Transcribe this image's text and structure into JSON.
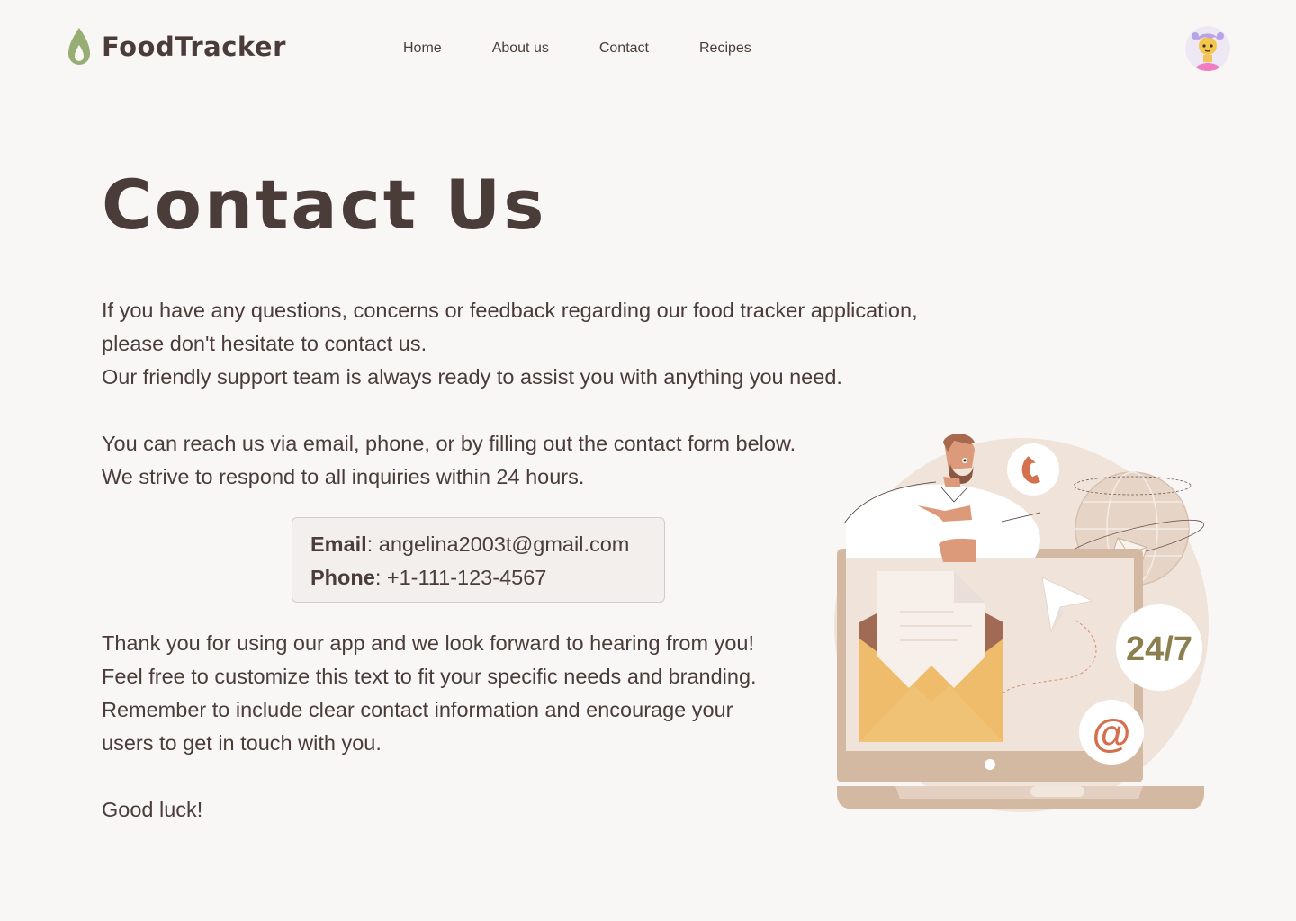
{
  "brand": {
    "name": "FoodTracker",
    "logo_icon": "leaf-drop-icon",
    "accent_color": "#96ad73"
  },
  "nav": {
    "items": [
      "Home",
      "About us",
      "Contact",
      "Recipes"
    ]
  },
  "user": {
    "avatar_icon": "user-avatar-icon"
  },
  "main": {
    "title": "Contact Us",
    "intro": "If you have any questions, concerns or feedback regarding our food tracker application,\nplease don't hesitate to contact us.\nOur friendly support team is always ready to assist you with anything you need.",
    "reach": "You can reach us via email, phone, or by filling out the contact form below.\nWe strive to respond to all inquiries within 24 hours.",
    "contact": {
      "email_label": "Email",
      "email_value": ": angelina2003t@gmail.com",
      "phone_label": "Phone",
      "phone_value": ": +1-111-123-4567"
    },
    "closing": "Thank you for using our app and we look forward to hearing from you!\nFeel free to customize this text to fit your specific needs and branding.\nRemember to include clear contact information and encourage your\n users to get in touch with you.",
    "signoff": "Good luck!"
  },
  "illustration": {
    "badge_247": "24/7",
    "at_symbol": "@",
    "icons": [
      "phone-icon",
      "envelope-icon",
      "paper-plane-icon",
      "globe-icon",
      "laptop-icon",
      "support-agent-icon"
    ]
  },
  "colors": {
    "background": "#f9f7f5",
    "text": "#4a3c39",
    "contact_box_bg": "#f3efec",
    "contact_box_border": "#d4cbc6",
    "badge_text": "#8b7f4f",
    "at_color": "#d4704e"
  }
}
